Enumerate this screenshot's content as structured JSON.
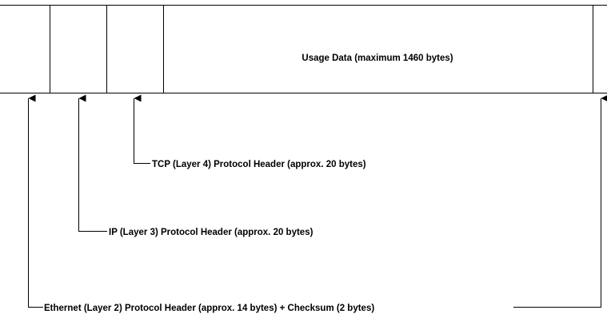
{
  "frame": {
    "payload_label": "Usage Data (maximum 1460 bytes)"
  },
  "callouts": {
    "tcp": "TCP (Layer 4) Protocol Header (approx. 20 bytes)",
    "ip": "IP (Layer 3) Protocol Header (approx. 20 bytes)",
    "ethernet": "Ethernet (Layer 2) Protocol Header (approx. 14 bytes) + Checksum (2 bytes)"
  },
  "colors": {
    "line": "#000000",
    "background": "#ffffff"
  }
}
